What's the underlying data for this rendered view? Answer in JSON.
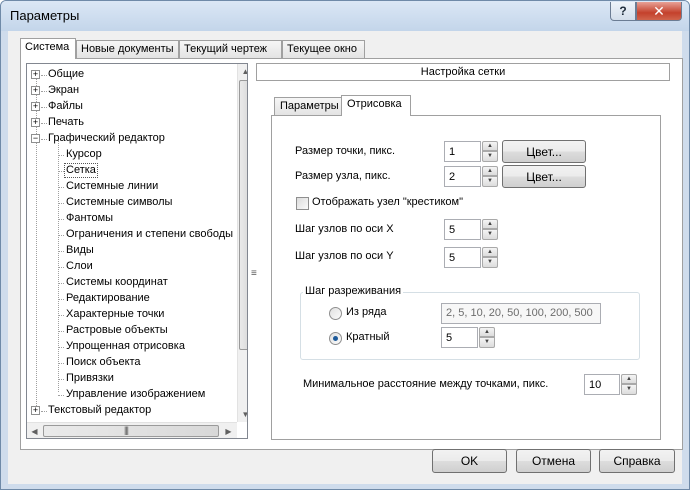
{
  "window": {
    "title": "Параметры",
    "help_button": "?",
    "close_button": "✕"
  },
  "main_tabs": [
    {
      "label": "Система",
      "active": true
    },
    {
      "label": "Новые документы",
      "active": false
    },
    {
      "label": "Текущий чертеж",
      "active": false
    },
    {
      "label": "Текущее окно",
      "active": false
    }
  ],
  "tree": {
    "items": [
      {
        "label": "Общие",
        "expander": "+"
      },
      {
        "label": "Экран",
        "expander": "+"
      },
      {
        "label": "Файлы",
        "expander": "+"
      },
      {
        "label": "Печать",
        "expander": "+"
      },
      {
        "label": "Графический редактор",
        "expander": "−"
      },
      {
        "label": "Курсор"
      },
      {
        "label": "Сетка",
        "selected": true
      },
      {
        "label": "Системные линии"
      },
      {
        "label": "Системные символы"
      },
      {
        "label": "Фантомы"
      },
      {
        "label": "Ограничения и степени свободы"
      },
      {
        "label": "Виды"
      },
      {
        "label": "Слои"
      },
      {
        "label": "Системы координат"
      },
      {
        "label": "Редактирование"
      },
      {
        "label": "Характерные точки"
      },
      {
        "label": "Растровые объекты"
      },
      {
        "label": "Упрощенная отрисовка"
      },
      {
        "label": "Поиск объекта"
      },
      {
        "label": "Привязки"
      },
      {
        "label": "Управление изображением"
      },
      {
        "label": "Текстовый редактор",
        "expander": "+"
      }
    ]
  },
  "panel": {
    "header": "Настройка сетки",
    "tabs": [
      {
        "label": "Параметры",
        "active": false
      },
      {
        "label": "Отрисовка",
        "active": true
      }
    ],
    "point_size_label": "Размер точки, пикс.",
    "point_size_value": "1",
    "node_size_label": "Размер узла, пикс.",
    "node_size_value": "2",
    "color_button": "Цвет...",
    "cross_checkbox_label": "Отображать узел \"крестиком\"",
    "cross_checked": false,
    "step_x_label": "Шаг узлов по оси X",
    "step_x_value": "5",
    "step_y_label": "Шаг узлов по оси Y",
    "step_y_value": "5",
    "thinning_group_title": "Шаг разреживания",
    "from_series_label": "Из ряда",
    "series_value": "2, 5, 10, 20, 50, 100, 200, 500",
    "multiple_label": "Кратный",
    "multiple_value": "5",
    "selected_mode": "Кратный",
    "min_distance_label": "Минимальное расстояние между точками, пикс.",
    "min_distance_value": "10"
  },
  "footer": {
    "ok": "OK",
    "cancel": "Отмена",
    "help": "Справка"
  },
  "colors": {
    "title_bar": "#cfdcec",
    "close_button": "#c4412c",
    "selected_item_border": "#a0a0a0"
  }
}
